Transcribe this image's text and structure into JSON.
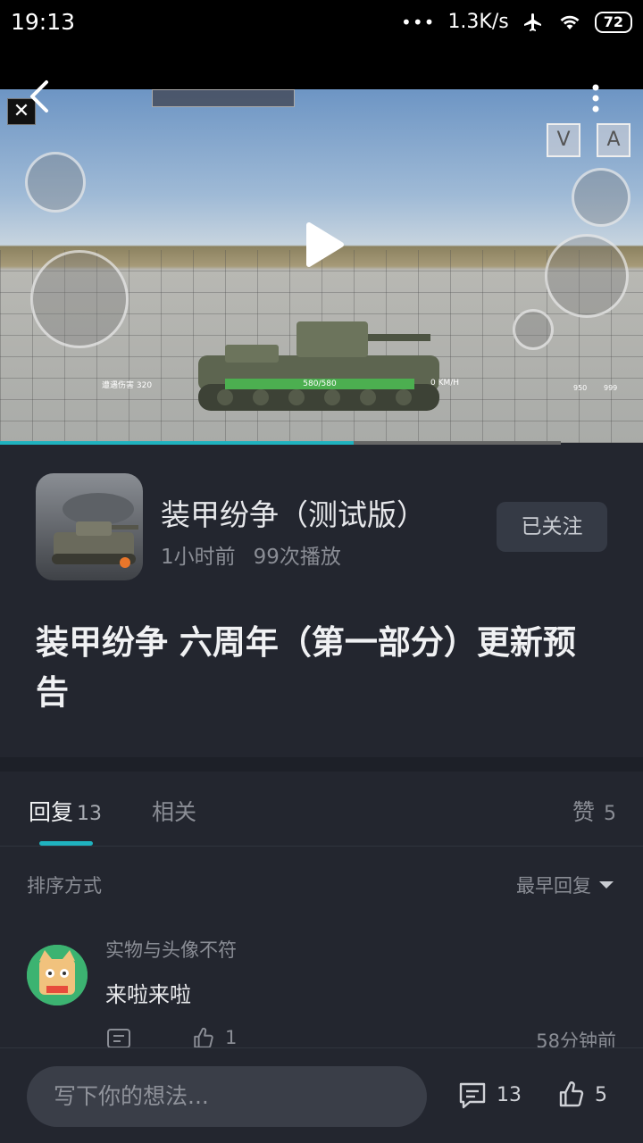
{
  "status_bar": {
    "time": "19:13",
    "network_speed": "1.3K/s",
    "battery": "72"
  },
  "video": {
    "progress_fraction": 0.63,
    "hud": {
      "health": "580/580",
      "speed": "0 KM/H",
      "damage": "遭遇伤害 320",
      "key_v": "V",
      "key_a": "A",
      "ammo_1": "950",
      "ammo_2": "999"
    }
  },
  "game": {
    "title": "装甲纷争（测试版）",
    "time_ago": "1小时前",
    "plays": "99次播放",
    "follow_label": "已关注"
  },
  "post": {
    "title": "装甲纷争 六周年（第一部分）更新预告"
  },
  "tabs": {
    "replies_label": "回复",
    "replies_count": "13",
    "related_label": "相关",
    "likes_label": "赞",
    "likes_count": "5"
  },
  "sort": {
    "label": "排序方式",
    "value": "最早回复"
  },
  "comment": {
    "user": "实物与头像不符",
    "text": "来啦来啦",
    "likes": "1",
    "time": "58分钟前"
  },
  "bottom_bar": {
    "input_placeholder": "写下你的想法...",
    "comment_count": "13",
    "like_count": "5"
  },
  "colors": {
    "accent": "#1fb2bf",
    "background": "#23262f"
  }
}
